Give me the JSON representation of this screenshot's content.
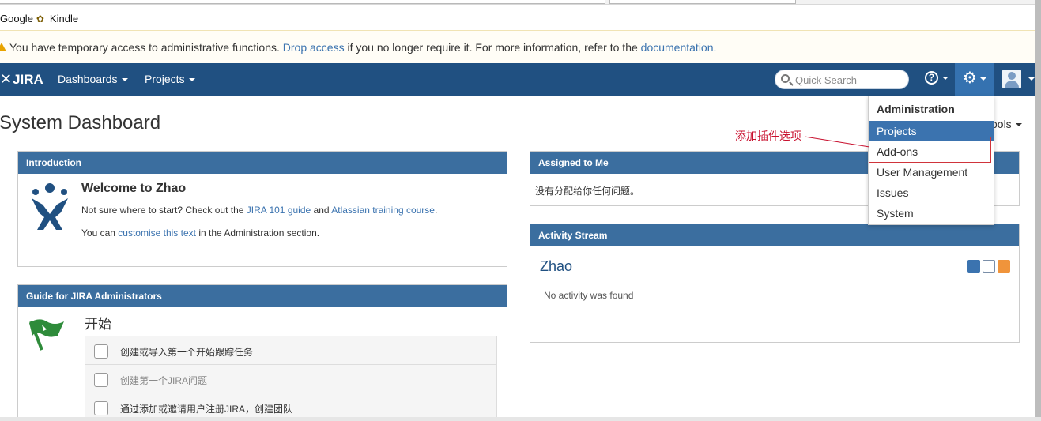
{
  "bookmarks": {
    "items": [
      "Google",
      "Kindle"
    ]
  },
  "banner": {
    "text_1": "You have temporary access to administrative functions.",
    "drop_access": "Drop access",
    "text_2": "if you no longer require it. For more information, refer to the",
    "documentation": "documentation."
  },
  "header": {
    "logo": "JIRA",
    "nav": [
      "Dashboards",
      "Projects"
    ],
    "search_placeholder": "Quick Search",
    "help_symbol": "?"
  },
  "page": {
    "title": "System Dashboard",
    "tools_label": "ools"
  },
  "introduction": {
    "title": "Introduction",
    "welcome": "Welcome to Zhao",
    "line1_a": "Not sure where to start? Check out the",
    "line1_link1": "JIRA 101 guide",
    "line1_b": "and",
    "line1_link2": "Atlassian training course",
    "line1_c": ".",
    "line2_a": "You can",
    "line2_link": "customise this text",
    "line2_b": "in the Administration section."
  },
  "guide": {
    "title": "Guide for JIRA Administrators",
    "start": "开始",
    "tasks": [
      "创建或导入第一个开始跟踪任务",
      "创建第一个JIRA问题",
      "通过添加或邀请用户注册JIRA，创建团队"
    ]
  },
  "assigned": {
    "title": "Assigned to Me",
    "empty_text": "没有分配给你任何问题。"
  },
  "activity": {
    "title": "Activity Stream",
    "user": "Zhao",
    "empty_text": "No activity was found"
  },
  "admin_menu": {
    "heading": "Administration",
    "items": [
      "Projects",
      "Add-ons",
      "User Management",
      "Issues",
      "System"
    ]
  },
  "annotation": {
    "text": "添加插件选项"
  },
  "colors": {
    "header": "#205081",
    "gadget_header": "#3b6e9f",
    "link": "#3b73af",
    "annotation": "#c8102e"
  }
}
